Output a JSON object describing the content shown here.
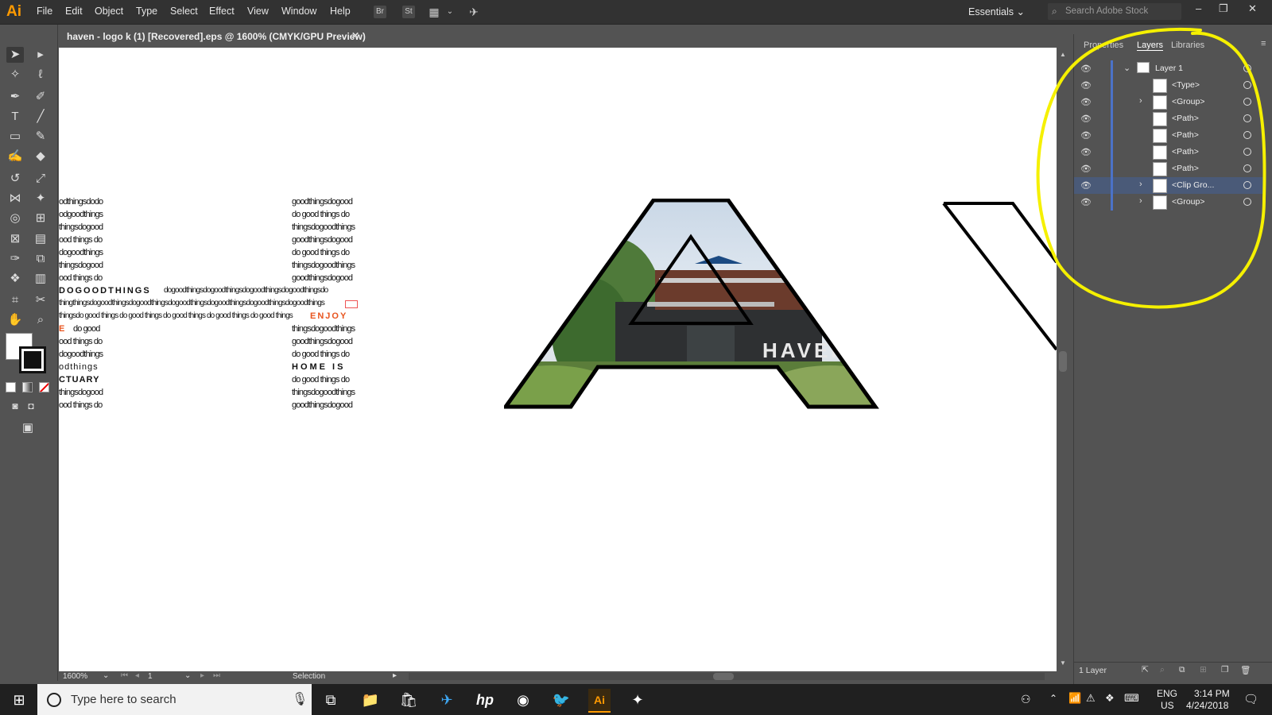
{
  "app": {
    "logo": "Ai"
  },
  "menu": [
    "File",
    "Edit",
    "Object",
    "Type",
    "Select",
    "Effect",
    "View",
    "Window",
    "Help"
  ],
  "menubar_icons": {
    "bridge": "Br",
    "stock": "St"
  },
  "workspace": "Essentials",
  "search_stock": {
    "placeholder": "Search Adobe Stock"
  },
  "document_tab": {
    "title": "haven - logo k (1) [Recovered].eps @ 1600% (CMYK/GPU Preview)",
    "close": "✕"
  },
  "status": {
    "zoom": "1600%",
    "artboard": "1",
    "tool": "Selection"
  },
  "panel": {
    "tabs": [
      "Properties",
      "Layers",
      "Libraries"
    ],
    "layers": [
      {
        "name": "Layer 1"
      },
      {
        "name": "<Type>"
      },
      {
        "name": "<Group>"
      },
      {
        "name": "<Path>"
      },
      {
        "name": "<Path>"
      },
      {
        "name": "<Path>"
      },
      {
        "name": "<Path>"
      },
      {
        "name": "<Clip Gro..."
      },
      {
        "name": "<Group>"
      }
    ],
    "footer": "1 Layer"
  },
  "canvas_text": {
    "left": [
      "odthingsdodo",
      "odgoodthings",
      "thingsdogood",
      "ood things do",
      "dogoodthings",
      "thingsdogood",
      "ood things do",
      "DOGOODTHINGS",
      "thingthingsdogoodthingsdogoodthingsdogoodthingsdogoodthingsdogoodthingsdogoodthings",
      "thingsdo good things do good things do good things do good things do good things",
      "E",
      "ood things do",
      "dogoodthings",
      "odthings",
      "CTUARY",
      "thingsdogood",
      "ood things do"
    ],
    "mid_line_8": "dogoodthingsdogoodthingsdogoodthingsdogoodthingsdo",
    "mid_line_11": "do good",
    "right": [
      "goodthingsdogood",
      "do good things do",
      "thingsdogoodthings",
      "goodthingsdogood",
      "do good things do",
      "thingsdogoodthings",
      "goodthingsdogood",
      "",
      "",
      "ENJOY",
      "thingsdogoodthings",
      "goodthingsdogood",
      "do good things do",
      "HOME IS",
      "do good things do",
      "thingsdogoodthings",
      "goodthingsdogood"
    ],
    "haven": "HAVEN"
  },
  "taskbar": {
    "search_placeholder": "Type here to search",
    "lang": "ENG",
    "region": "US",
    "time": "3:14 PM",
    "date": "4/24/2018"
  },
  "colors": {
    "accent": "#FF9A00",
    "highlight": "#F5F000",
    "selection": "#4B72C8",
    "enjoy": "#E8541E"
  }
}
